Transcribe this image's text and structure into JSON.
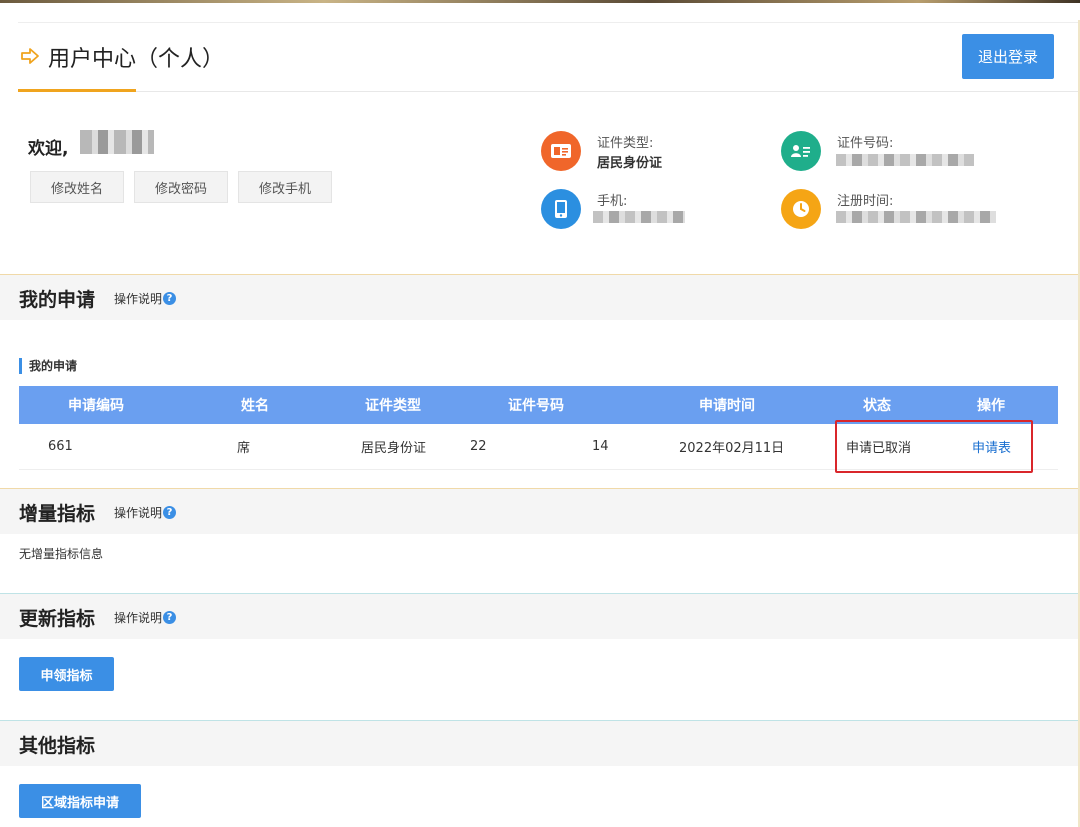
{
  "header": {
    "title": "用户中心（个人）",
    "logout_label": "退出登录"
  },
  "profile": {
    "welcome": "欢迎,",
    "buttons": [
      "修改姓名",
      "修改密码",
      "修改手机"
    ],
    "id_type_label": "证件类型:",
    "id_type_value": "居民身份证",
    "id_number_label": "证件号码:",
    "phone_label": "手机:",
    "register_label": "注册时间:"
  },
  "sections": {
    "applications": {
      "title": "我的申请",
      "help": "操作说明"
    },
    "increment": {
      "title": "增量指标",
      "help": "操作说明",
      "empty_text": "无增量指标信息"
    },
    "renewal": {
      "title": "更新指标",
      "help": "操作说明",
      "button": "申领指标"
    },
    "other": {
      "title": "其他指标",
      "button": "区域指标申请"
    }
  },
  "applications_table": {
    "subtitle": "我的申请",
    "columns": [
      "申请编码",
      "姓名",
      "证件类型",
      "证件号码",
      "申请时间",
      "状态",
      "操作"
    ],
    "rows": [
      {
        "code": "661",
        "name": "席",
        "id_type": "居民身份证",
        "id_number_start": "22",
        "id_number_end": "14",
        "apply_time": "2022年02月11日",
        "status": "申请已取消",
        "action": "申请表"
      }
    ]
  },
  "colors": {
    "accent_blue": "#3b8fe5",
    "table_header": "#6a9ff0",
    "title_underline": "#f0a41e",
    "highlight_red": "#d9262b",
    "icon_orange": "#f0662a",
    "icon_green": "#1fae8b",
    "icon_blue": "#2b8fe0",
    "icon_yellow": "#f5a515"
  }
}
